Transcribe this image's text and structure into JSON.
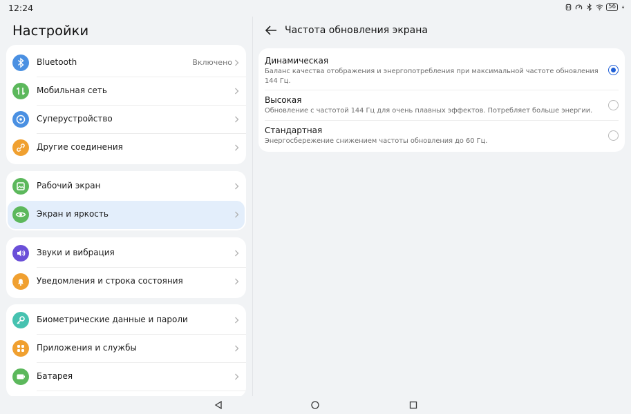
{
  "status_bar": {
    "time": "12:24",
    "battery": "56",
    "icons": [
      "nfc-icon",
      "speed-icon",
      "bluetooth-icon",
      "wifi-icon",
      "battery-icon",
      "charging-icon"
    ]
  },
  "settings": {
    "title": "Настройки",
    "groups": [
      {
        "items": [
          {
            "label": "Bluetooth",
            "value": "Включено",
            "icon": "bluetooth-icon",
            "color": "#4a90e2"
          },
          {
            "label": "Мобильная сеть",
            "icon": "mobile-network-icon",
            "color": "#5cb85c"
          },
          {
            "label": "Суперустройство",
            "icon": "super-device-icon",
            "color": "#4a90e2"
          },
          {
            "label": "Другие соединения",
            "icon": "link-icon",
            "color": "#f0a030"
          }
        ]
      },
      {
        "items": [
          {
            "label": "Рабочий экран",
            "icon": "home-screen-icon",
            "color": "#5cb85c"
          },
          {
            "label": "Экран и яркость",
            "icon": "eye-icon",
            "color": "#5cb85c",
            "selected": true
          }
        ]
      },
      {
        "items": [
          {
            "label": "Звуки и вибрация",
            "icon": "sound-icon",
            "color": "#6a4fd8"
          },
          {
            "label": "Уведомления и строка состояния",
            "icon": "bell-icon",
            "color": "#f0a030"
          }
        ]
      },
      {
        "items": [
          {
            "label": "Биометрические данные и пароли",
            "icon": "key-icon",
            "color": "#46c2b0"
          },
          {
            "label": "Приложения и службы",
            "icon": "apps-icon",
            "color": "#f0a030"
          },
          {
            "label": "Батарея",
            "icon": "battery-icon",
            "color": "#5cb85c"
          }
        ]
      }
    ]
  },
  "detail": {
    "title": "Частота обновления экрана",
    "options": [
      {
        "title": "Динамическая",
        "description": "Баланс качества отображения и энергопотребления при максимальной частоте обновления 144 Гц.",
        "selected": true
      },
      {
        "title": "Высокая",
        "description": "Обновление с частотой 144 Гц для очень плавных эффектов. Потребляет больше энергии.",
        "selected": false
      },
      {
        "title": "Стандартная",
        "description": "Энергосбережение снижением частоты обновления до 60 Гц.",
        "selected": false
      }
    ]
  },
  "accent_color": "#1f5fd6",
  "selected_row_color": "#e3eefb"
}
